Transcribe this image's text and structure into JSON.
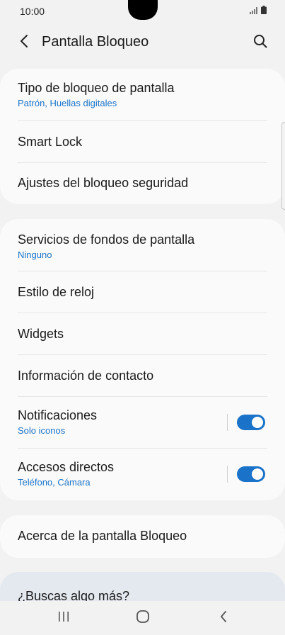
{
  "status_bar": {
    "time": "10:00"
  },
  "app_bar": {
    "title": "Pantalla Bloqueo"
  },
  "section1": {
    "items": [
      {
        "title": "Tipo de bloqueo de pantalla",
        "subtitle": "Patrón, Huellas digitales"
      },
      {
        "title": "Smart Lock"
      },
      {
        "title": "Ajustes del bloqueo seguridad"
      }
    ]
  },
  "section2": {
    "items": [
      {
        "title": "Servicios de fondos de pantalla",
        "subtitle": "Ninguno"
      },
      {
        "title": "Estilo de reloj"
      },
      {
        "title": "Widgets"
      },
      {
        "title": "Información de contacto"
      },
      {
        "title": "Notificaciones",
        "subtitle": "Solo iconos",
        "toggle_on": true
      },
      {
        "title": "Accesos directos",
        "subtitle": "Teléfono, Cámara",
        "toggle_on": true
      }
    ]
  },
  "section3": {
    "items": [
      {
        "title": "Acerca de la pantalla Bloqueo"
      }
    ]
  },
  "more": {
    "text": "¿Buscas algo más?"
  },
  "colors": {
    "accent": "#1a73c8",
    "background": "#f2f2f2",
    "card": "#fafafa"
  },
  "icons": [
    "back-icon",
    "search-icon",
    "signal-icon",
    "battery-icon",
    "recents-icon",
    "home-icon",
    "nav-back-icon"
  ]
}
